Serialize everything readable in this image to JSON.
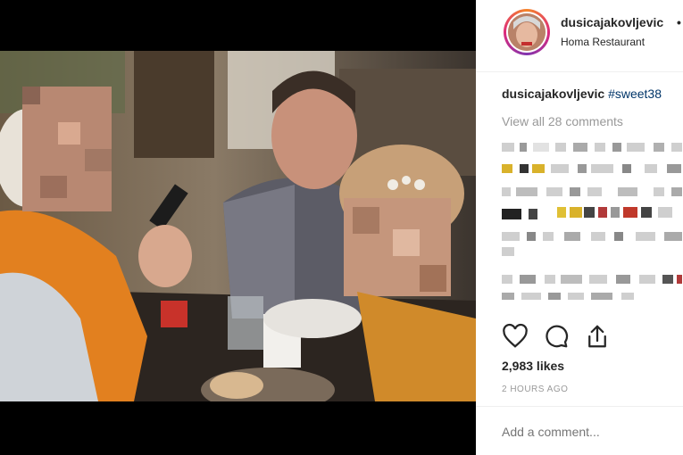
{
  "post": {
    "username": "dusicajakovljevic",
    "follow_separator": "•",
    "location": "Homa Restaurant",
    "caption": {
      "username": "dusicajakovljevic",
      "hashtag": "#sweet38"
    },
    "view_comments": "View all 28 comments",
    "likes": "2,983 likes",
    "timestamp": "2 HOURS AGO",
    "comment_placeholder": "Add a comment..."
  },
  "icons": {
    "like": "heart-icon",
    "comment": "comment-icon",
    "share": "share-icon"
  },
  "colors": {
    "text": "#262626",
    "muted": "#999999",
    "hashtag": "#003569",
    "divider": "#efefef"
  }
}
